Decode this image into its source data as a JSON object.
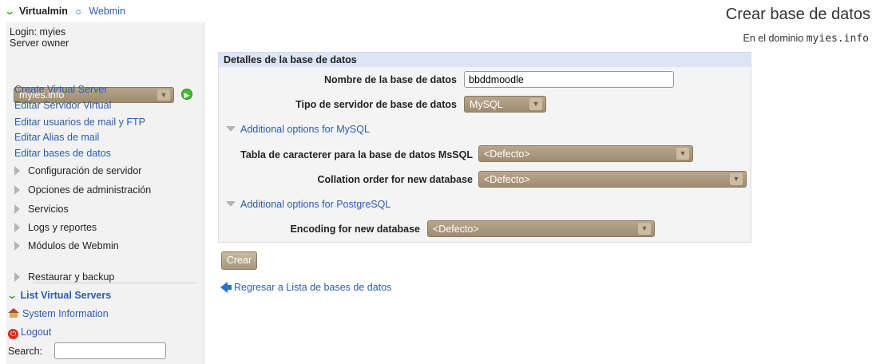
{
  "header": {
    "brand": "Virtualmin",
    "webmin_link": "Webmin"
  },
  "sidebar": {
    "login_line": "Login: myies",
    "role_line": "Server owner",
    "domain_select": "myies.info",
    "links": [
      "Create Virtual Server",
      "Editar Servidor Virtual",
      "Editar usuarios de mail y FTP",
      "Editar Alias de mail",
      "Editar bases de datos"
    ],
    "sections": [
      "Configuración de servidor",
      "Opciones de administración",
      "Servicios",
      "Logs y reportes",
      "Módulos de Webmin",
      "Restaurar y backup"
    ],
    "list_virtual_servers": "List Virtual Servers",
    "system_information": "System Information",
    "logout": "Logout",
    "search_label": "Search:",
    "search_value": ""
  },
  "page": {
    "title": "Crear base de datos",
    "subtitle_prefix": "En el dominio",
    "subtitle_domain": "myies.info"
  },
  "form": {
    "panel_title": "Detalles de la base de datos",
    "db_name_label": "Nombre de la base de datos",
    "db_name_value": "bbddmoodle",
    "db_type_label": "Tipo de servidor de base de datos",
    "db_type_value": "MySQL",
    "mysql_options_toggle": "Additional options for MySQL",
    "charset_label": "Tabla de caracterer para la base de datos MsSQL",
    "charset_value": "<Defecto>",
    "collation_label": "Collation order for new database",
    "collation_value": "<Defecto>",
    "postgres_options_toggle": "Additional options for PostgreSQL",
    "encoding_label": "Encoding for new database",
    "encoding_value": "<Defecto>",
    "submit_label": "Crear",
    "back_link": "Regresar a Lista de bases de datos"
  }
}
